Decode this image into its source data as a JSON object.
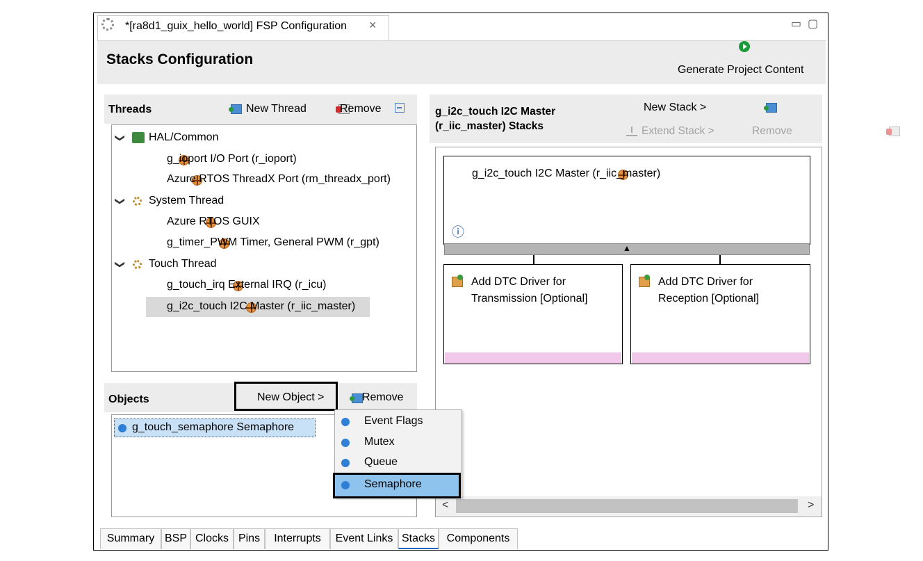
{
  "tab": {
    "title": "*[ra8d1_guix_hello_world] FSP Configuration",
    "close_glyph": "×"
  },
  "window_buttons": {
    "minimize": "▭",
    "maximize": "▢"
  },
  "header": {
    "title": "Stacks Configuration",
    "generate_label": "Generate Project Content"
  },
  "threads": {
    "title": "Threads",
    "new_thread_label": "New Thread",
    "remove_label": "Remove",
    "tree": [
      {
        "label": "HAL/Common",
        "indent": 0,
        "icon": "hal-icon",
        "expanded": true
      },
      {
        "label": "g_ioport I/O Port (r_ioport)",
        "indent": 1,
        "icon": "module-icon"
      },
      {
        "label": "Azure RTOS ThreadX Port (rm_threadx_port)",
        "indent": 1,
        "icon": "module-icon"
      },
      {
        "label": "System Thread",
        "indent": 0,
        "icon": "gear-icon",
        "expanded": true
      },
      {
        "label": "Azure RTOS GUIX",
        "indent": 1,
        "icon": "module-icon"
      },
      {
        "label": "g_timer_PWM Timer, General PWM (r_gpt)",
        "indent": 1,
        "icon": "module-icon"
      },
      {
        "label": "Touch Thread",
        "indent": 0,
        "icon": "gear-icon",
        "expanded": true
      },
      {
        "label": "g_touch_irq External IRQ (r_icu)",
        "indent": 1,
        "icon": "module-icon"
      },
      {
        "label": "g_i2c_touch I2C Master (r_iic_master)",
        "indent": 1,
        "icon": "module-icon",
        "selected": true
      }
    ]
  },
  "objects": {
    "title": "Objects",
    "new_object_label": "New Object >",
    "remove_label": "Remove",
    "items": [
      "g_touch_semaphore Semaphore"
    ]
  },
  "object_menu": {
    "items": [
      "Event Flags",
      "Mutex",
      "Queue",
      "Semaphore"
    ],
    "highlighted": "Semaphore"
  },
  "stacks": {
    "title_line1": "g_i2c_touch I2C Master",
    "title_line2": "(r_iic_master) Stacks",
    "new_stack_label": "New Stack >",
    "extend_stack_label": "Extend Stack >",
    "remove_label": "Remove",
    "main_module": "g_i2c_touch I2C Master (r_iic_master)",
    "info_glyph": "ⓘ",
    "collapse_glyph": "▲",
    "sub_modules": [
      {
        "line1": "Add DTC Driver for",
        "line2": "Transmission [Optional]"
      },
      {
        "line1": "Add DTC Driver for",
        "line2": "Reception [Optional]"
      }
    ],
    "scroll_left": "<",
    "scroll_right": ">"
  },
  "bottom_tabs": [
    "Summary",
    "BSP",
    "Clocks",
    "Pins",
    "Interrupts",
    "Event Links",
    "Stacks",
    "Components"
  ],
  "active_bottom_tab": "Stacks",
  "colors": {
    "highlight_menu": "#8ec3ee",
    "selection": "#c9e1f7",
    "pink_bar": "#f2c8ea",
    "gray_bar": "#b4b4b4"
  }
}
